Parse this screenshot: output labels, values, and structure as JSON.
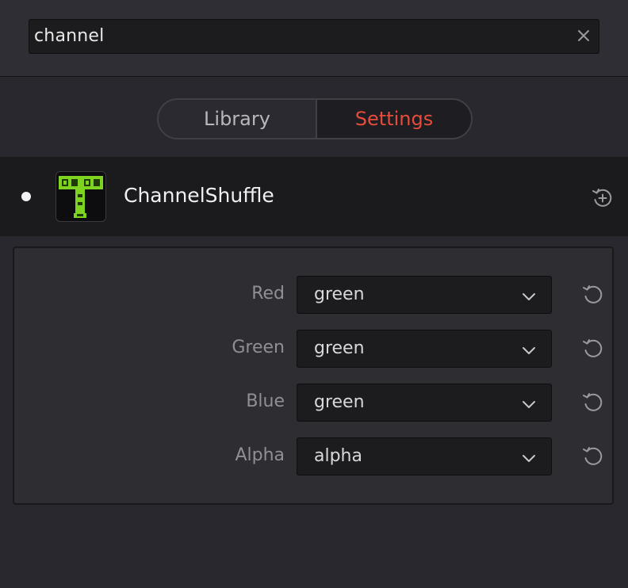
{
  "search": {
    "value": "channel",
    "clear_icon": "close-icon"
  },
  "tabs": [
    {
      "label": "Library",
      "active": false
    },
    {
      "label": "Settings",
      "active": true,
      "color": "#e64b3c"
    }
  ],
  "tool": {
    "name": "ChannelShuffle",
    "icon": "channel-shuffle-tool-icon",
    "icon_color": "#7ed321",
    "reset_icon": "reset-add-icon"
  },
  "channels": [
    {
      "label": "Red",
      "value": "green"
    },
    {
      "label": "Green",
      "value": "green"
    },
    {
      "label": "Blue",
      "value": "green"
    },
    {
      "label": "Alpha",
      "value": "alpha"
    }
  ],
  "colors": {
    "background": "#28282e",
    "accent": "#e64b3c",
    "icon_green": "#7ed321"
  }
}
